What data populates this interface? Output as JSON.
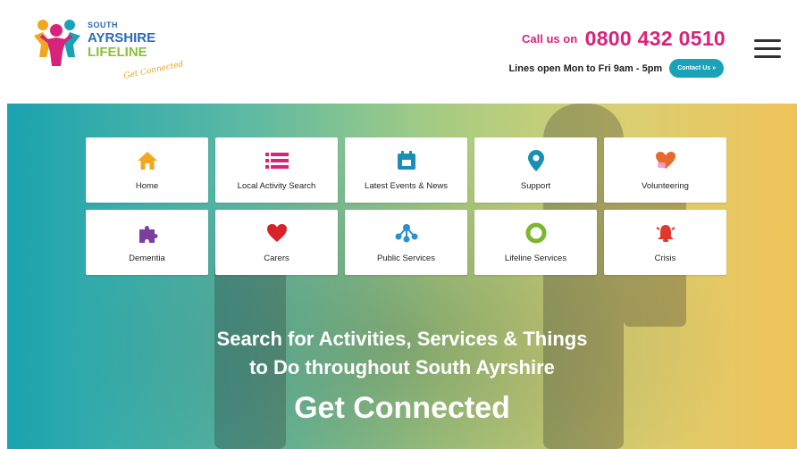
{
  "logo": {
    "line1": "SOUTH",
    "line2": "AYRSHIRE",
    "line3": "LIFELINE",
    "tagline": "Get Connected"
  },
  "header": {
    "call_label": "Call us on",
    "phone": "0800 432 0510",
    "hours": "Lines open Mon to Fri 9am - 5pm",
    "contact_button": "Contact Us »"
  },
  "tiles": [
    {
      "label": "Home",
      "icon": "home-icon",
      "color": "#f0a81e"
    },
    {
      "label": "Local Activity Search",
      "icon": "list-icon",
      "color": "#d8237a"
    },
    {
      "label": "Latest Events & News",
      "icon": "calendar-icon",
      "color": "#1a8fb5"
    },
    {
      "label": "Support",
      "icon": "map-pin-icon",
      "color": "#1a8fb5"
    },
    {
      "label": "Volunteering",
      "icon": "heart-hand-icon",
      "color": "#e8692e"
    },
    {
      "label": "Dementia",
      "icon": "puzzle-icon",
      "color": "#7b3fa0"
    },
    {
      "label": "Carers",
      "icon": "heart-icon",
      "color": "#d8232a"
    },
    {
      "label": "Public Services",
      "icon": "network-icon",
      "color": "#2b8fd0"
    },
    {
      "label": "Lifeline Services",
      "icon": "lifebuoy-icon",
      "color": "#7cb62f"
    },
    {
      "label": "Crisis",
      "icon": "alarm-bell-icon",
      "color": "#e03a2e"
    }
  ],
  "hero": {
    "line1": "Search for Activities, Services & Things",
    "line2": "to Do throughout South Ayrshire",
    "title": "Get Connected"
  }
}
